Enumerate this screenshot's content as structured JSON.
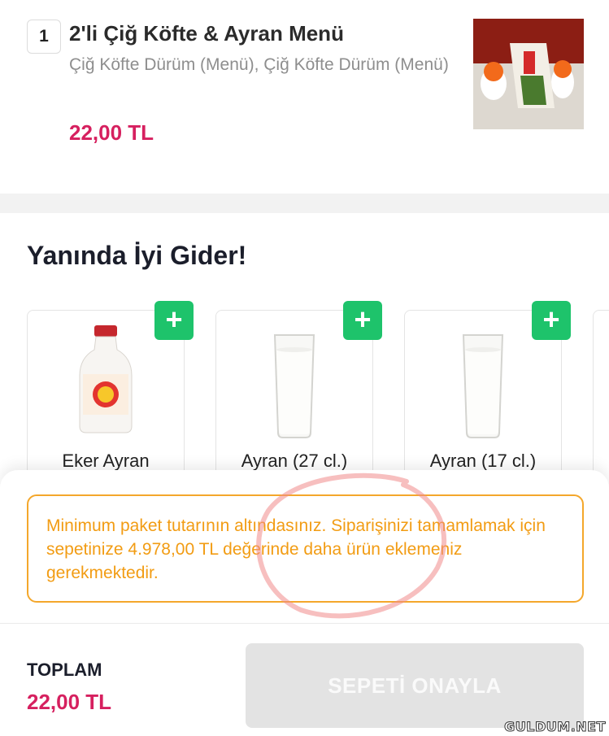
{
  "cart_item": {
    "quantity": "1",
    "title": "2'li Çiğ Köfte & Ayran Menü",
    "description": "Çiğ Köfte Dürüm (Menü), Çiğ Köfte Dürüm (Menü)",
    "price": "22,00 TL"
  },
  "suggestions": {
    "title": "Yanında İyi Gider!",
    "add_symbol": "+",
    "items": [
      {
        "name": "Eker Ayran",
        "icon": "ayran-bottle-icon"
      },
      {
        "name": "Ayran (27 cl.)",
        "icon": "glass-icon"
      },
      {
        "name": "Ayran (17 cl.)",
        "icon": "glass-icon"
      }
    ]
  },
  "bottom_sheet": {
    "warning": "Minimum paket tutarının altındasınız. Siparişinizi tamamlamak için sepetinize 4.978,00 TL değerinde daha ürün eklemeniz gerekmektedir.",
    "total_label": "TOPLAM",
    "total_value": "22,00 TL",
    "confirm_label": "SEPETİ ONAYLA"
  },
  "colors": {
    "price": "#d6205f",
    "add_button": "#1ec36b",
    "warning": "#f29c13",
    "button_disabled": "#e3e3e3"
  },
  "watermark": "GULDUM.NET"
}
